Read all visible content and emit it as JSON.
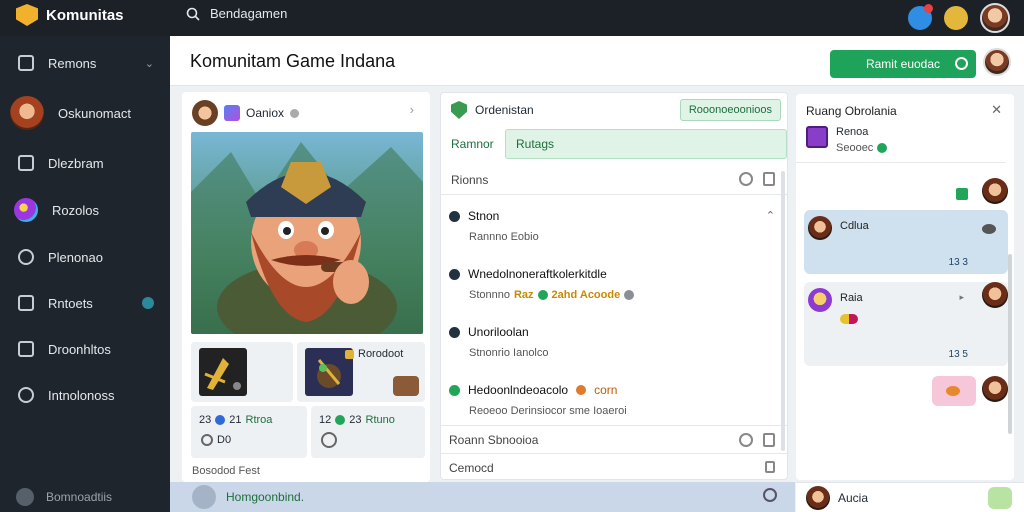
{
  "app": {
    "name": "Komunitas"
  },
  "search": {
    "placeholder": "Bendagamen"
  },
  "sidebar": {
    "items": [
      {
        "label": "Remons"
      },
      {
        "label": "Oskunomact"
      },
      {
        "label": "Dlezbram"
      },
      {
        "label": "Rozolos"
      },
      {
        "label": "Plenonao"
      },
      {
        "label": "Rntoets"
      },
      {
        "label": "Droonhltos"
      },
      {
        "label": "Intnolonoss"
      }
    ],
    "footer": "Bomnoadtiis"
  },
  "header": {
    "title": "Komunitam Game Indana",
    "join_label": "Ramit euodac"
  },
  "post": {
    "author": "Oaniox",
    "thumb_label": "Rorodoot",
    "stats": [
      {
        "a": "23",
        "b": "21",
        "label": "Rtroa",
        "c": "D0"
      },
      {
        "a": "12",
        "b": "23",
        "label": "Rtuno"
      }
    ],
    "footer": "Bosodod Fest"
  },
  "discussion": {
    "title": "Ordenistan",
    "pill": "Rooonoeoonioos",
    "tabs": [
      {
        "label": "Ramnor"
      },
      {
        "label": "Rutags"
      }
    ],
    "list_header": "Rionns",
    "threads": [
      {
        "title": "Stnon",
        "sub": "Rannno Eobio"
      },
      {
        "title": "Wnedolnoneraftkolerkitdle",
        "sub_prefix": "Stonnno",
        "sub_highlight_a": "Raz",
        "sub_highlight_b": "2ahd Acoode"
      },
      {
        "title": "Unoriloolan",
        "sub": "Stnonrio Ianolco"
      },
      {
        "title": "Hedoonlndeoacolo",
        "title_suffix": "corn",
        "sub": "Reoeoo Derinsiocor sme Ioaeroi"
      }
    ],
    "footer_a": "Roann Sbnooioa",
    "footer_b": "Cemocd"
  },
  "chat": {
    "title": "Ruang Obrolania",
    "user_name": "Renoa",
    "user_status": "Seooec",
    "messages": [
      {
        "who": "Cdlua",
        "time": "13 3"
      },
      {
        "who": "Raia",
        "time": "13 5"
      }
    ]
  },
  "composer": {
    "placeholder": "Homgoonbind."
  },
  "chat_composer": {
    "name": "Aucia"
  }
}
